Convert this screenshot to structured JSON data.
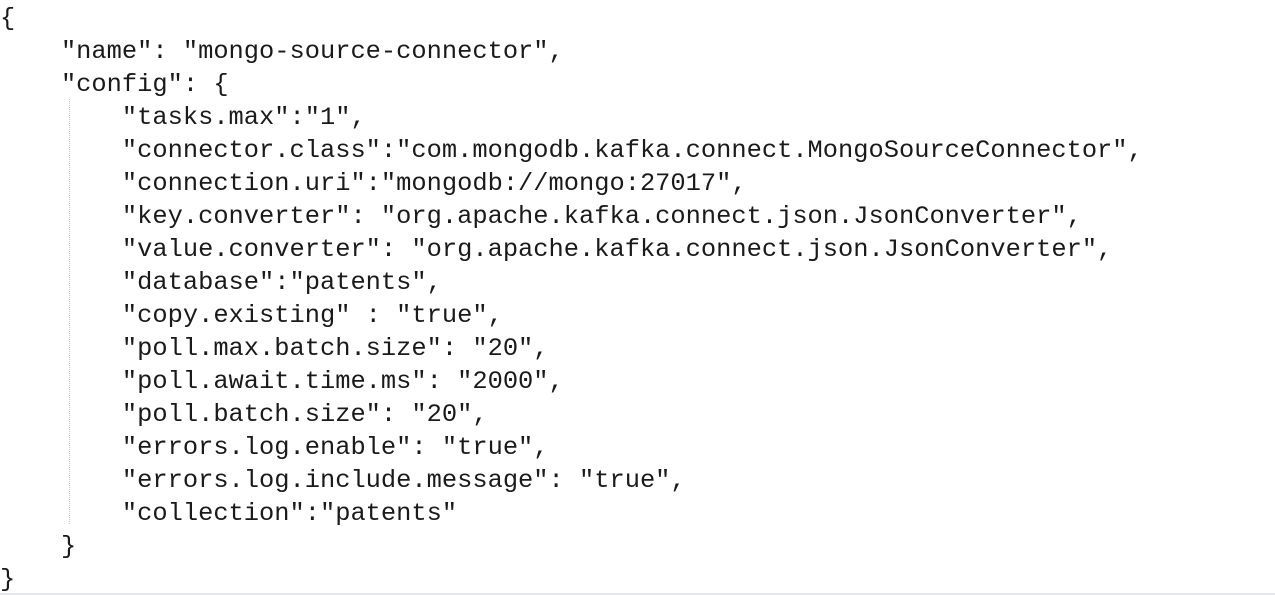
{
  "editor": {
    "lines": [
      "{",
      "    \"name\": \"mongo-source-connector\",",
      "    \"config\": {",
      "        \"tasks.max\":\"1\",",
      "        \"connector.class\":\"com.mongodb.kafka.connect.MongoSourceConnector\",",
      "        \"connection.uri\":\"mongodb://mongo:27017\",",
      "        \"key.converter\": \"org.apache.kafka.connect.json.JsonConverter\",",
      "        \"value.converter\": \"org.apache.kafka.connect.json.JsonConverter\",",
      "        \"database\":\"patents\",",
      "        \"copy.existing\" : \"true\",",
      "        \"poll.max.batch.size\": \"20\",",
      "        \"poll.await.time.ms\": \"2000\",",
      "        \"poll.batch.size\": \"20\",",
      "        \"errors.log.enable\": \"true\",",
      "        \"errors.log.include.message\": \"true\",",
      "        \"collection\":\"patents\"",
      "    }",
      "}"
    ]
  }
}
